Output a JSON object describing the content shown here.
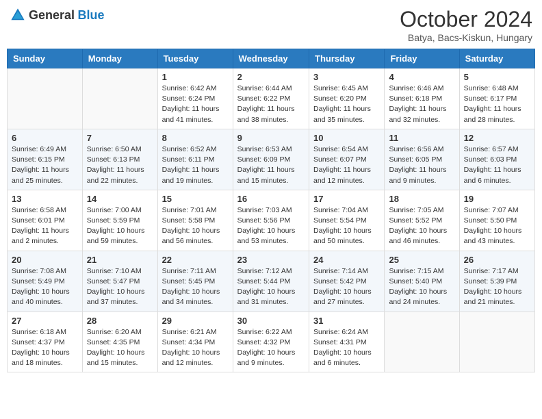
{
  "header": {
    "logo_general": "General",
    "logo_blue": "Blue",
    "title": "October 2024",
    "subtitle": "Batya, Bacs-Kiskun, Hungary"
  },
  "weekdays": [
    "Sunday",
    "Monday",
    "Tuesday",
    "Wednesday",
    "Thursday",
    "Friday",
    "Saturday"
  ],
  "weeks": [
    [
      {
        "day": "",
        "info": ""
      },
      {
        "day": "",
        "info": ""
      },
      {
        "day": "1",
        "info": "Sunrise: 6:42 AM\nSunset: 6:24 PM\nDaylight: 11 hours and 41 minutes."
      },
      {
        "day": "2",
        "info": "Sunrise: 6:44 AM\nSunset: 6:22 PM\nDaylight: 11 hours and 38 minutes."
      },
      {
        "day": "3",
        "info": "Sunrise: 6:45 AM\nSunset: 6:20 PM\nDaylight: 11 hours and 35 minutes."
      },
      {
        "day": "4",
        "info": "Sunrise: 6:46 AM\nSunset: 6:18 PM\nDaylight: 11 hours and 32 minutes."
      },
      {
        "day": "5",
        "info": "Sunrise: 6:48 AM\nSunset: 6:17 PM\nDaylight: 11 hours and 28 minutes."
      }
    ],
    [
      {
        "day": "6",
        "info": "Sunrise: 6:49 AM\nSunset: 6:15 PM\nDaylight: 11 hours and 25 minutes."
      },
      {
        "day": "7",
        "info": "Sunrise: 6:50 AM\nSunset: 6:13 PM\nDaylight: 11 hours and 22 minutes."
      },
      {
        "day": "8",
        "info": "Sunrise: 6:52 AM\nSunset: 6:11 PM\nDaylight: 11 hours and 19 minutes."
      },
      {
        "day": "9",
        "info": "Sunrise: 6:53 AM\nSunset: 6:09 PM\nDaylight: 11 hours and 15 minutes."
      },
      {
        "day": "10",
        "info": "Sunrise: 6:54 AM\nSunset: 6:07 PM\nDaylight: 11 hours and 12 minutes."
      },
      {
        "day": "11",
        "info": "Sunrise: 6:56 AM\nSunset: 6:05 PM\nDaylight: 11 hours and 9 minutes."
      },
      {
        "day": "12",
        "info": "Sunrise: 6:57 AM\nSunset: 6:03 PM\nDaylight: 11 hours and 6 minutes."
      }
    ],
    [
      {
        "day": "13",
        "info": "Sunrise: 6:58 AM\nSunset: 6:01 PM\nDaylight: 11 hours and 2 minutes."
      },
      {
        "day": "14",
        "info": "Sunrise: 7:00 AM\nSunset: 5:59 PM\nDaylight: 10 hours and 59 minutes."
      },
      {
        "day": "15",
        "info": "Sunrise: 7:01 AM\nSunset: 5:58 PM\nDaylight: 10 hours and 56 minutes."
      },
      {
        "day": "16",
        "info": "Sunrise: 7:03 AM\nSunset: 5:56 PM\nDaylight: 10 hours and 53 minutes."
      },
      {
        "day": "17",
        "info": "Sunrise: 7:04 AM\nSunset: 5:54 PM\nDaylight: 10 hours and 50 minutes."
      },
      {
        "day": "18",
        "info": "Sunrise: 7:05 AM\nSunset: 5:52 PM\nDaylight: 10 hours and 46 minutes."
      },
      {
        "day": "19",
        "info": "Sunrise: 7:07 AM\nSunset: 5:50 PM\nDaylight: 10 hours and 43 minutes."
      }
    ],
    [
      {
        "day": "20",
        "info": "Sunrise: 7:08 AM\nSunset: 5:49 PM\nDaylight: 10 hours and 40 minutes."
      },
      {
        "day": "21",
        "info": "Sunrise: 7:10 AM\nSunset: 5:47 PM\nDaylight: 10 hours and 37 minutes."
      },
      {
        "day": "22",
        "info": "Sunrise: 7:11 AM\nSunset: 5:45 PM\nDaylight: 10 hours and 34 minutes."
      },
      {
        "day": "23",
        "info": "Sunrise: 7:12 AM\nSunset: 5:44 PM\nDaylight: 10 hours and 31 minutes."
      },
      {
        "day": "24",
        "info": "Sunrise: 7:14 AM\nSunset: 5:42 PM\nDaylight: 10 hours and 27 minutes."
      },
      {
        "day": "25",
        "info": "Sunrise: 7:15 AM\nSunset: 5:40 PM\nDaylight: 10 hours and 24 minutes."
      },
      {
        "day": "26",
        "info": "Sunrise: 7:17 AM\nSunset: 5:39 PM\nDaylight: 10 hours and 21 minutes."
      }
    ],
    [
      {
        "day": "27",
        "info": "Sunrise: 6:18 AM\nSunset: 4:37 PM\nDaylight: 10 hours and 18 minutes."
      },
      {
        "day": "28",
        "info": "Sunrise: 6:20 AM\nSunset: 4:35 PM\nDaylight: 10 hours and 15 minutes."
      },
      {
        "day": "29",
        "info": "Sunrise: 6:21 AM\nSunset: 4:34 PM\nDaylight: 10 hours and 12 minutes."
      },
      {
        "day": "30",
        "info": "Sunrise: 6:22 AM\nSunset: 4:32 PM\nDaylight: 10 hours and 9 minutes."
      },
      {
        "day": "31",
        "info": "Sunrise: 6:24 AM\nSunset: 4:31 PM\nDaylight: 10 hours and 6 minutes."
      },
      {
        "day": "",
        "info": ""
      },
      {
        "day": "",
        "info": ""
      }
    ]
  ]
}
